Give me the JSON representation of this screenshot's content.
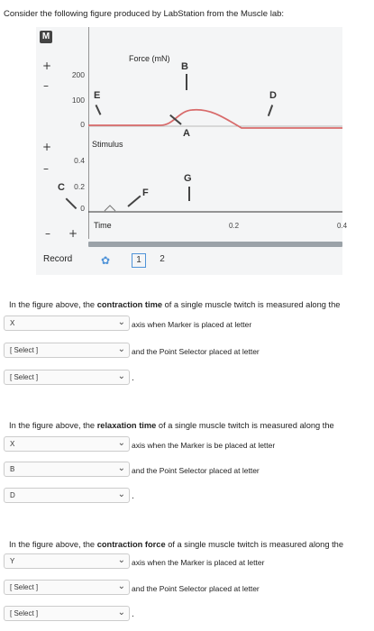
{
  "intro": "Consider the following figure produced by LabStation from the Muscle lab:",
  "figure": {
    "badge": "M",
    "plus": "+",
    "minus": "–",
    "force_ticks": [
      "200",
      "100",
      "0"
    ],
    "stim_ticks": [
      "0.4",
      "0.2",
      "0"
    ],
    "force_title": "Force (mN)",
    "stim_title": "Stimulus",
    "time_title": "Time",
    "x_ticks": [
      "0.2",
      "0.4"
    ],
    "markers": {
      "A": "A",
      "B": "B",
      "C": "C",
      "D": "D",
      "E": "E",
      "F": "F",
      "G": "G"
    },
    "record": "Record",
    "gear_icon": "gear-icon",
    "pages": [
      "1",
      "2"
    ]
  },
  "questions": [
    {
      "pre": "In the figure above, the ",
      "bold": "contraction time",
      "post": " of a single muscle twitch is measured along the",
      "axis_value": "X",
      "after_axis": "axis when Marker is placed at letter",
      "marker_value": "[ Select ]",
      "after_marker": "and the Point Selector placed at letter",
      "point_value": "[ Select ]"
    },
    {
      "pre": "In the figure above, the ",
      "bold": "relaxation time",
      "post": " of a single muscle twitch is measured along the",
      "axis_value": "X",
      "after_axis": "axis when the Marker is be placed at letter",
      "marker_value": "B",
      "after_marker": "and the Point Selector placed at letter",
      "point_value": "D"
    },
    {
      "pre": "In the figure above, the ",
      "bold": "contraction force",
      "post": " of a single muscle twitch is measured along the",
      "axis_value": "Y",
      "after_axis": "axis when the Marker is placed at letter",
      "marker_value": "[ Select ]",
      "after_marker": "and the Point Selector placed at letter",
      "point_value": "[ Select ]"
    }
  ]
}
